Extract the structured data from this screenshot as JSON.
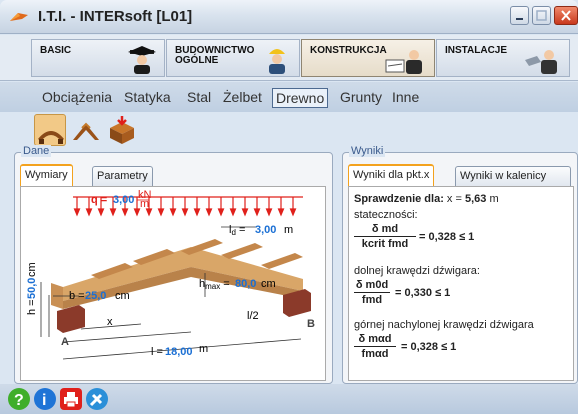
{
  "window": {
    "title": "I.T.I. - INTERsoft [L01]"
  },
  "modules": [
    {
      "label": "BASIC",
      "active": false
    },
    {
      "label": "BUDOWNICTWO\nOGÓLNE",
      "active": false
    },
    {
      "label": "KONSTRUKCJA",
      "active": true
    },
    {
      "label": "INSTALACJE",
      "active": false
    }
  ],
  "subtabs": [
    "Obciążenia",
    "Statyka",
    "Stal",
    "Żelbet",
    "Drewno",
    "Grunty",
    "Inne"
  ],
  "active_subtab": "Drewno",
  "toolbar": {
    "tools": [
      "beam-icon",
      "gable-icon",
      "column-icon"
    ],
    "active_index": 0
  },
  "dane": {
    "title": "Dane",
    "tabs": [
      "Wymiary",
      "Parametry"
    ],
    "active_tab": "Wymiary",
    "drawing": {
      "q_label": "q =",
      "q_value": "3,00",
      "q_unit_num": "kN",
      "q_unit_den": "m",
      "ld_label": "l",
      "ld_sub": "d",
      "ld_value": "3,00",
      "ld_unit": "m",
      "h_label": "h =",
      "h_value": "50,0",
      "h_unit": "cm",
      "b_label": "b =",
      "b_value": "25,0",
      "b_unit": "cm",
      "hmax_label": "h",
      "hmax_sub": "max",
      "hmax_value": "80,0",
      "hmax_unit": "cm",
      "x_label": "x",
      "half_label": "l/2",
      "l_label": "l =",
      "l_value": "18,00",
      "l_unit": "m",
      "support_a": "A",
      "support_b": "B"
    }
  },
  "wyniki": {
    "title": "Wyniki",
    "tabs": [
      "Wyniki dla pkt.x",
      "Wyniki w kalenicy"
    ],
    "active_tab": "Wyniki dla pkt.x",
    "heading": "Sprawdzenie dla:",
    "x_label": "x =",
    "x_value": "5,63",
    "x_unit": "m",
    "check1_label": "stateczności:",
    "check1_num": "δ md",
    "check1_den": "kcrit fmd",
    "check1_result": "= 0,328 ≤ 1",
    "check2_label": "dolnej krawędzi dźwigara:",
    "check2_num": "δ m0d",
    "check2_den": "fmd",
    "check2_result": "= 0,330 ≤ 1",
    "check3_label": "górnej nachylonej krawędzi dźwigara",
    "check3_num": "δ mαd",
    "check3_den": "fmαd",
    "check3_result": "= 0,328 ≤ 1"
  },
  "statusbar": {
    "buttons": [
      "help-icon",
      "info-icon",
      "print-icon",
      "tools-icon"
    ]
  },
  "colors": {
    "accent_orange": "#f3a21e",
    "value_blue": "#1a6fd4",
    "load_red": "#e0201b"
  }
}
